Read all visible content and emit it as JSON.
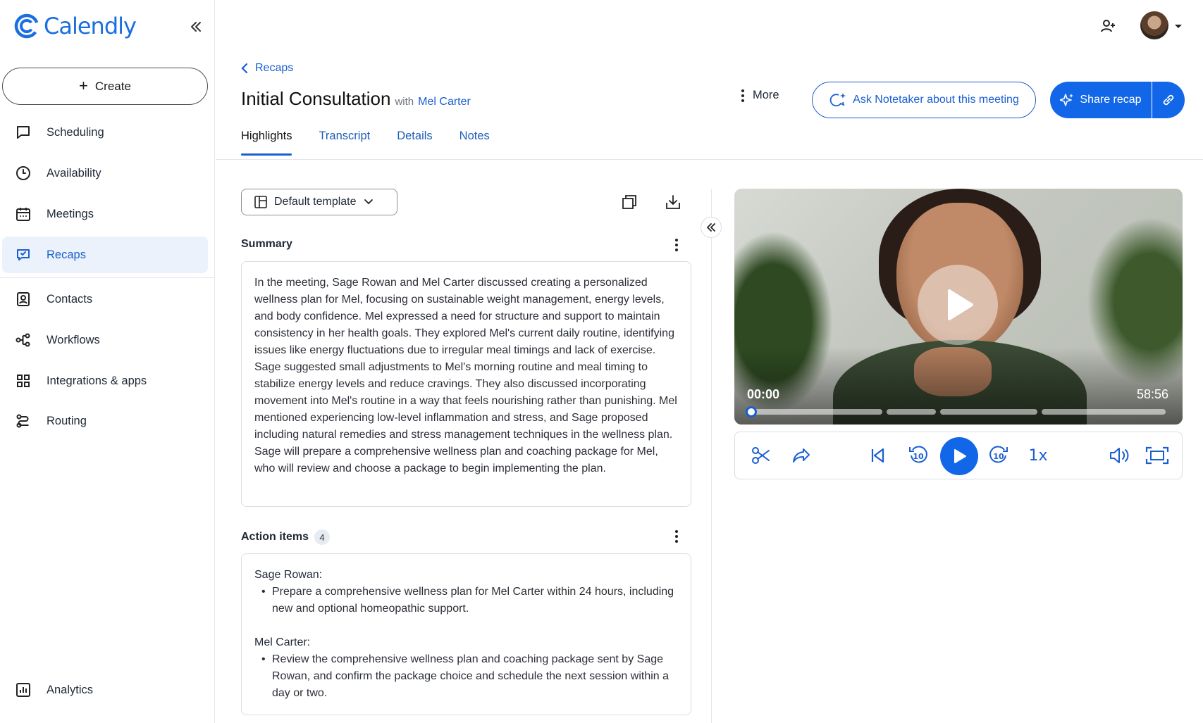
{
  "app": {
    "logo_text": "Calendly",
    "brand_color": "#1a6fe0"
  },
  "sidebar": {
    "create_label": "Create",
    "items": [
      {
        "label": "Scheduling",
        "icon": "chat-bubble-icon"
      },
      {
        "label": "Availability",
        "icon": "clock-icon"
      },
      {
        "label": "Meetings",
        "icon": "calendar-icon"
      },
      {
        "label": "Recaps",
        "icon": "recap-icon",
        "active": true
      },
      {
        "label": "Contacts",
        "icon": "contact-card-icon"
      },
      {
        "label": "Workflows",
        "icon": "workflow-icon"
      },
      {
        "label": "Integrations & apps",
        "icon": "grid-icon"
      },
      {
        "label": "Routing",
        "icon": "routing-icon"
      },
      {
        "label": "Analytics",
        "icon": "bar-chart-icon"
      }
    ]
  },
  "header": {
    "breadcrumb": "Recaps",
    "title": "Initial Consultation",
    "with_text": "with",
    "with_name": "Mel Carter",
    "more_label": "More",
    "ask_label": "Ask Notetaker about this meeting",
    "share_label": "Share recap",
    "tabs": [
      {
        "label": "Highlights",
        "active": true
      },
      {
        "label": "Transcript"
      },
      {
        "label": "Details"
      },
      {
        "label": "Notes"
      }
    ]
  },
  "content": {
    "template_label": "Default template",
    "summary_title": "Summary",
    "summary_text": "In the meeting, Sage Rowan and Mel Carter discussed creating a personalized wellness plan for Mel, focusing on sustainable weight management, energy levels, and body confidence. Mel expressed a need for structure and support to maintain consistency in her health goals. They explored Mel's current daily routine, identifying issues like energy fluctuations due to irregular meal timings and lack of exercise. Sage suggested small adjustments to Mel's morning routine and meal timing to stabilize energy levels and reduce cravings. They also discussed incorporating movement into Mel's routine in a way that feels nourishing rather than punishing. Mel mentioned experiencing low-level inflammation and stress, and Sage proposed including natural remedies and stress management techniques in the wellness plan. Sage will prepare a comprehensive wellness plan and coaching package for Mel, who will review and choose a package to begin implementing the plan.",
    "action_title": "Action items",
    "action_count": "4",
    "actions": [
      {
        "person": "Sage Rowan:",
        "items": [
          "Prepare a comprehensive wellness plan for Mel Carter within 24 hours, including new and optional homeopathic support."
        ]
      },
      {
        "person": "Mel Carter:",
        "items": [
          "Review the comprehensive wellness plan and coaching package sent by Sage Rowan, and confirm the package choice and schedule the next session within a day or two."
        ]
      }
    ]
  },
  "video": {
    "current_time": "00:00",
    "duration": "58:56",
    "progress": 0,
    "speed_label": "1x"
  }
}
